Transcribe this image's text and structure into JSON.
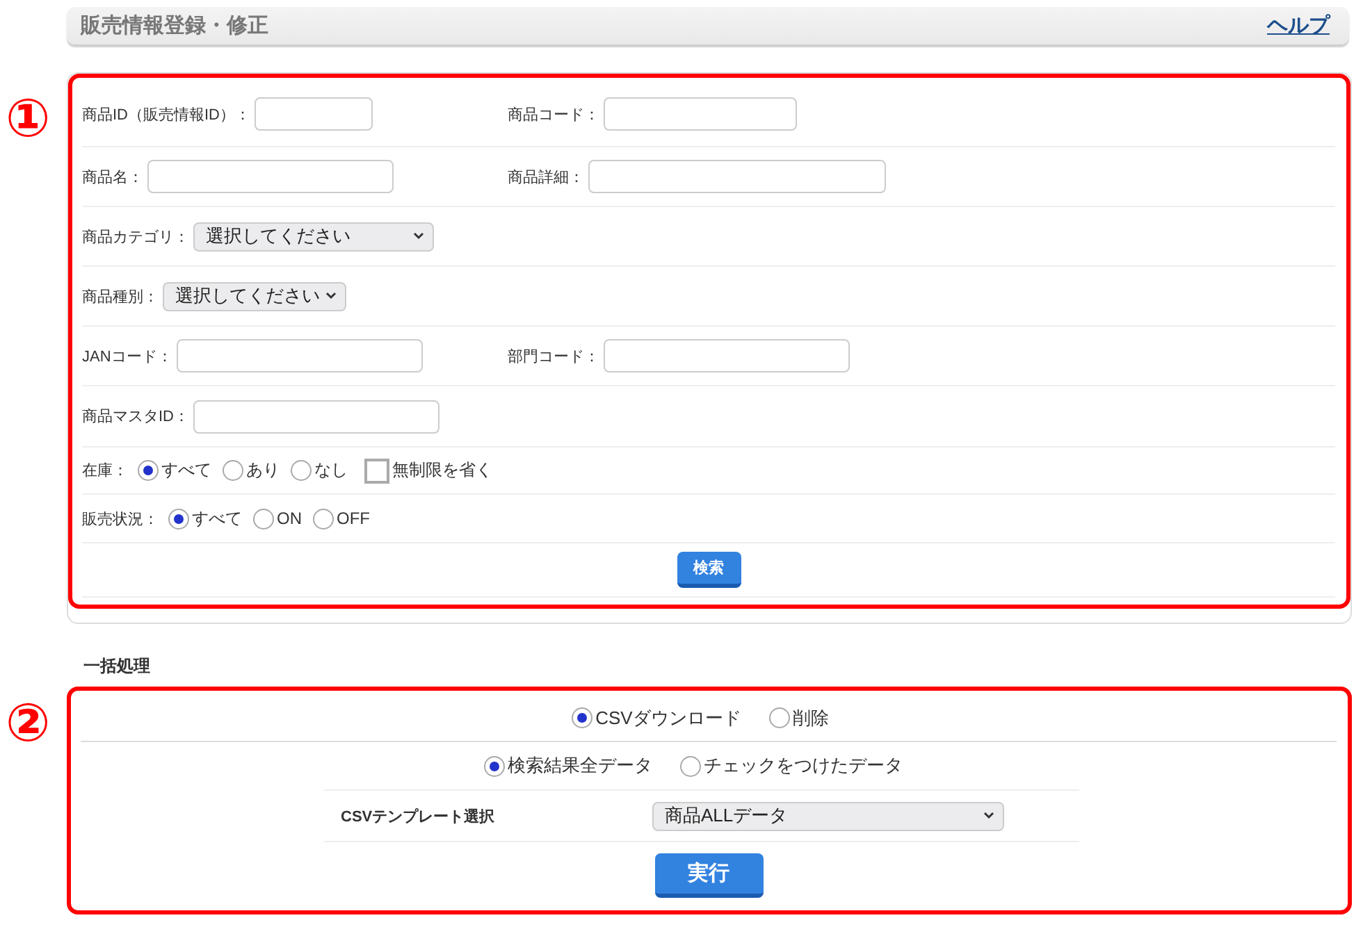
{
  "header": {
    "title": "販売情報登録・修正",
    "help_link": "ヘルプ"
  },
  "markers": [
    "①",
    "②"
  ],
  "search": {
    "rows": [
      {
        "kind": "fields",
        "fields": [
          {
            "label": "商品ID（販売情報ID）："
          },
          {
            "label": "商品コード："
          }
        ]
      },
      {
        "kind": "fields",
        "fields": [
          {
            "label": "商品名："
          },
          {
            "label": "商品詳細："
          }
        ]
      },
      {
        "kind": "select",
        "label": "商品カテゴリ：",
        "value": "選択してください"
      },
      {
        "kind": "select",
        "label": "商品種別：",
        "value": "選択してください"
      },
      {
        "kind": "fields",
        "fields": [
          {
            "label": "JANコード："
          },
          {
            "label": "部門コード："
          }
        ]
      },
      {
        "kind": "fields",
        "fields": [
          {
            "label": "商品マスタID："
          }
        ]
      },
      {
        "kind": "radios",
        "label": "在庫：",
        "options": [
          {
            "label": "すべて",
            "selected": true
          },
          {
            "label": "あり",
            "selected": false
          },
          {
            "label": "なし",
            "selected": false
          }
        ],
        "checkbox": {
          "label": "無制限を省く",
          "checked": false
        }
      },
      {
        "kind": "radios",
        "label": "販売状況：",
        "options": [
          {
            "label": "すべて",
            "selected": true
          },
          {
            "label": "ON",
            "selected": false
          },
          {
            "label": "OFF",
            "selected": false
          }
        ]
      }
    ],
    "button": "検索"
  },
  "bulk": {
    "title": "一括処理",
    "actions": [
      {
        "label": "CSVダウンロード",
        "selected": true
      },
      {
        "label": "削除",
        "selected": false
      }
    ],
    "targets": [
      {
        "label": "検索結果全データ",
        "selected": true
      },
      {
        "label": "チェックをつけたデータ",
        "selected": false
      }
    ],
    "template": {
      "label": "CSVテンプレート選択",
      "value": "商品ALLデータ"
    },
    "button": "実行"
  }
}
